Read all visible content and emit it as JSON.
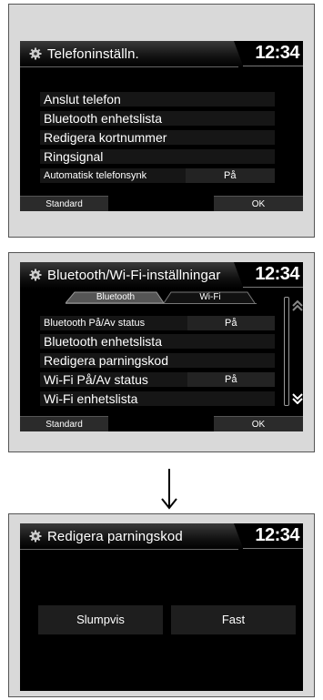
{
  "panel1": {
    "title": "Telefoninställn.",
    "clock": "12:34",
    "rows": [
      {
        "label": "Anslut telefon"
      },
      {
        "label": "Bluetooth enhetslista"
      },
      {
        "label": "Redigera kortnummer"
      },
      {
        "label": "Ringsignal"
      },
      {
        "label": "Automatisk telefonsynk",
        "value": "På"
      }
    ],
    "buttons": {
      "default": "Standard",
      "ok": "OK"
    }
  },
  "panel2": {
    "title": "Bluetooth/Wi-Fi-inställningar",
    "clock": "12:34",
    "tabs": [
      {
        "label": "Bluetooth",
        "active": true
      },
      {
        "label": "Wi-Fi",
        "active": false
      }
    ],
    "rows": [
      {
        "label": "Bluetooth På/Av status",
        "value": "På"
      },
      {
        "label": "Bluetooth enhetslista"
      },
      {
        "label": "Redigera parningskod"
      },
      {
        "label": "Wi-Fi På/Av status",
        "value": "På"
      },
      {
        "label": "Wi-Fi enhetslista"
      }
    ],
    "buttons": {
      "default": "Standard",
      "ok": "OK"
    },
    "icons": {
      "scroll_up": "double-chevron-up-icon",
      "scroll_down": "double-chevron-down-icon"
    }
  },
  "connector": {
    "icon": "down-arrow-icon"
  },
  "panel3": {
    "title": "Redigera parningskod",
    "clock": "12:34",
    "options": [
      {
        "label": "Slumpvis"
      },
      {
        "label": "Fast"
      }
    ]
  },
  "colors": {
    "screen_bg": "#000000",
    "row_bg": "#161616",
    "text": "#ffffff"
  }
}
